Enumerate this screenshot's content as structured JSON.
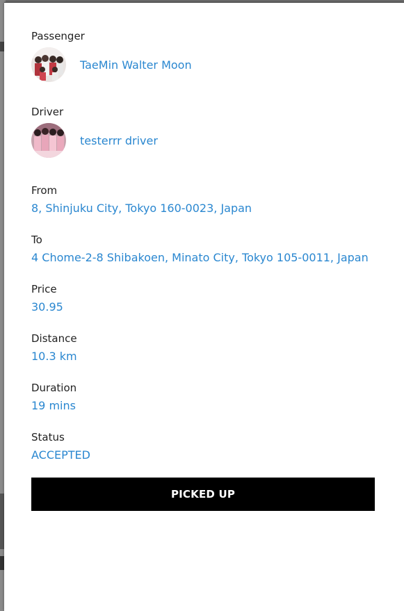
{
  "passenger": {
    "label": "Passenger",
    "name": "TaeMin Walter Moon"
  },
  "driver": {
    "label": "Driver",
    "name": "testerrr driver"
  },
  "trip": {
    "from_label": "From",
    "from_value": "8, Shinjuku City, Tokyo 160-0023, Japan",
    "to_label": "To",
    "to_value": "4 Chome-2-8 Shibakoen, Minato City, Tokyo 105-0011, Japan",
    "price_label": "Price",
    "price_value": "30.95",
    "distance_label": "Distance",
    "distance_value": "10.3 km",
    "duration_label": "Duration",
    "duration_value": "19 mins",
    "status_label": "Status",
    "status_value": "ACCEPTED"
  },
  "action": {
    "label": "PICKED UP"
  },
  "colors": {
    "accent": "#2a87d0",
    "button_bg": "#000000",
    "button_text": "#ffffff",
    "panel_bg": "#ffffff"
  }
}
